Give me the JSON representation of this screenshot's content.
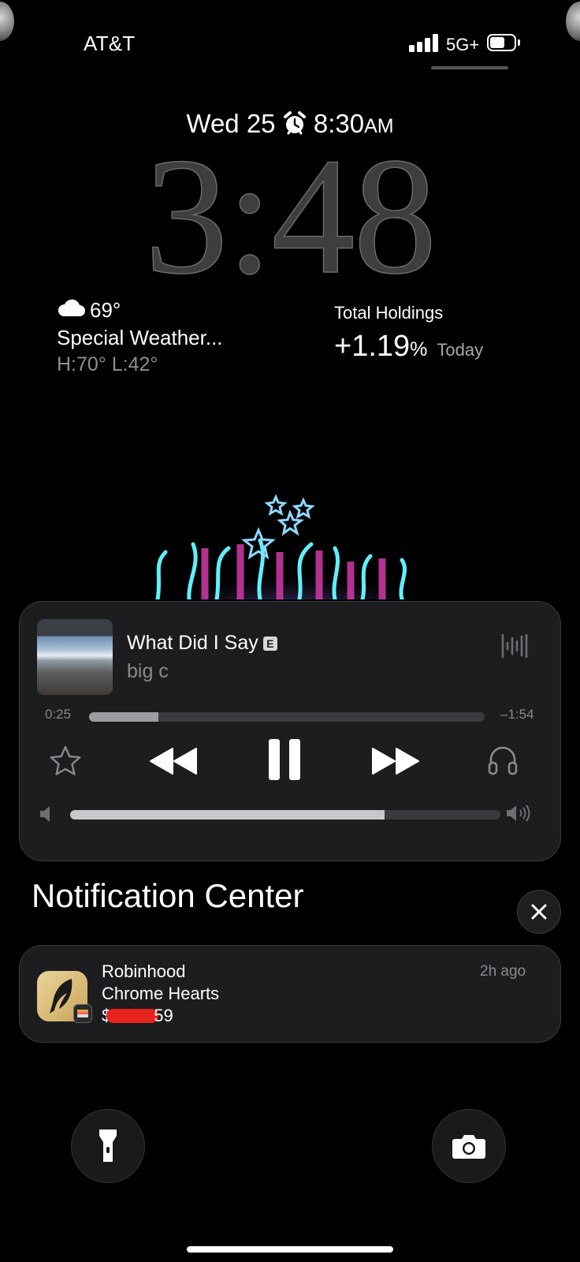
{
  "status_bar": {
    "carrier": "AT&T",
    "network": "5G+"
  },
  "lock": {
    "date": "Wed 25",
    "alarm_time": "8:30",
    "alarm_ampm": "AM",
    "time": "3:48"
  },
  "weather": {
    "temp": "69°",
    "condition": "Special Weather...",
    "high_low": "H:70° L:42°",
    "icon": "cloud-icon"
  },
  "stocks": {
    "title": "Total Holdings",
    "change_value": "+1.19",
    "change_unit": "%",
    "period": "Today"
  },
  "player": {
    "song": "What Did I Say",
    "explicit_badge": "E",
    "artist": "big c",
    "elapsed": "0:25",
    "remaining": "–1:54",
    "progress": 0.175,
    "volume": 0.73
  },
  "notification_center": {
    "title": "Notification Center",
    "items": [
      {
        "app": "Robinhood",
        "title": "Chrome Hearts",
        "body_prefix": "$",
        "body_suffix": "59",
        "time": "2h ago"
      }
    ]
  }
}
